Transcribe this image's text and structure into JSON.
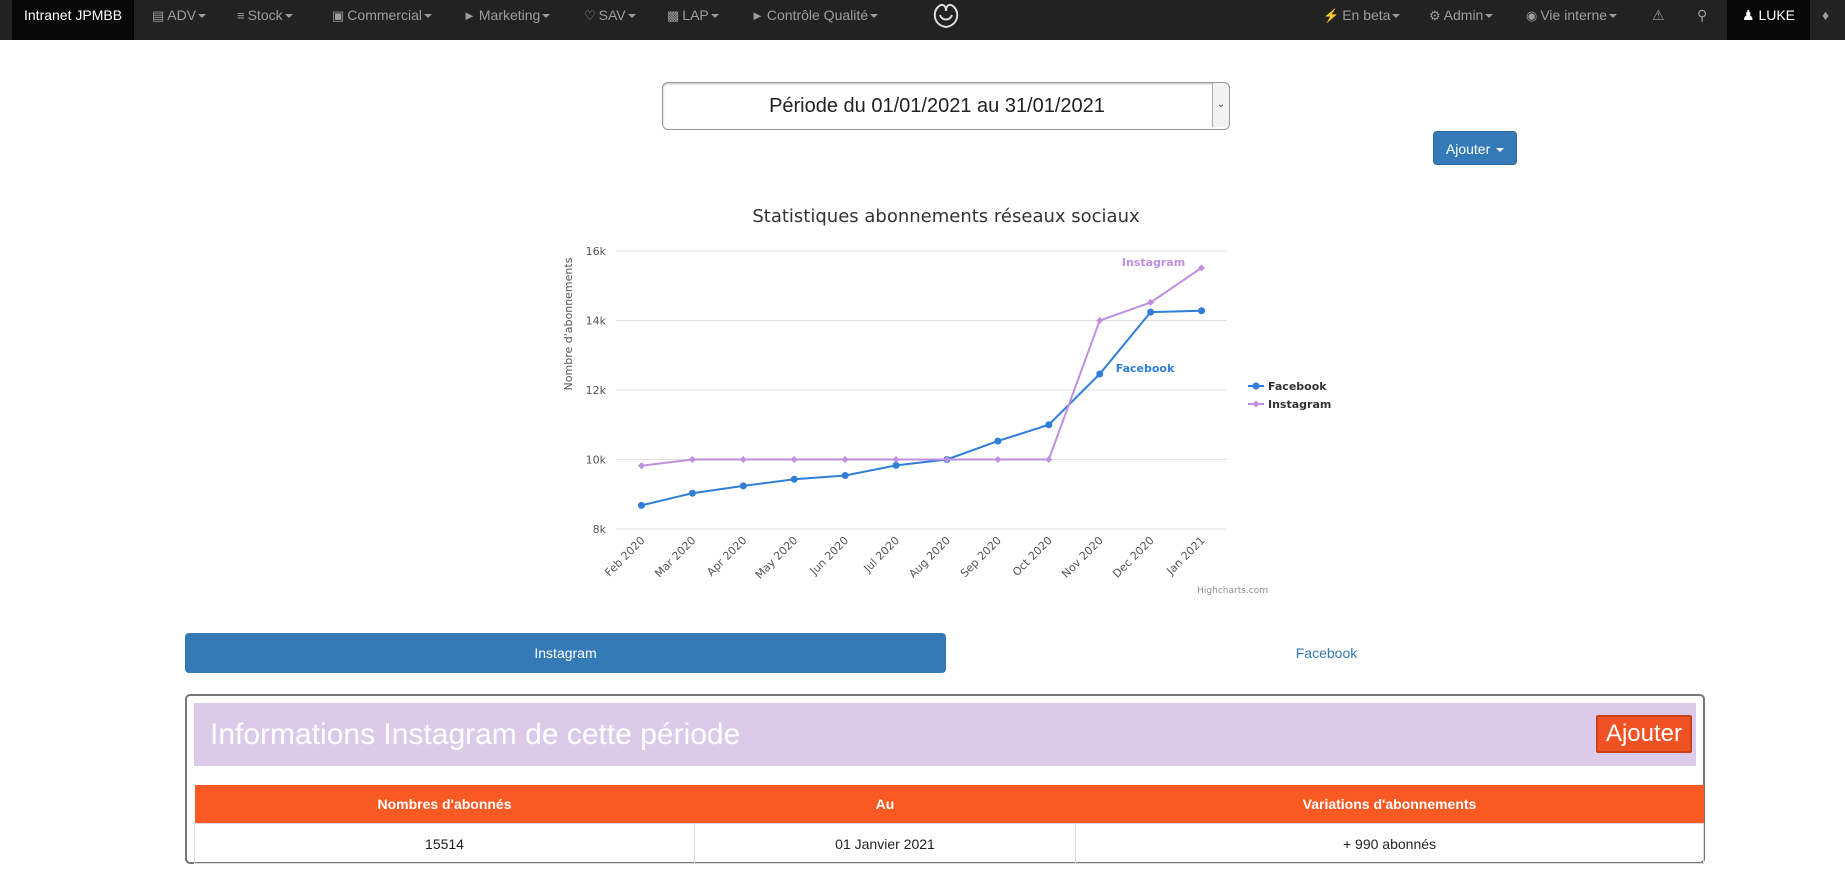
{
  "navbar": {
    "brand": "Intranet JPMBB",
    "items": [
      {
        "label": "ADV",
        "icon": "inbox-icon"
      },
      {
        "label": "Stock",
        "icon": "list-icon"
      },
      {
        "label": "Commercial",
        "icon": "cart-icon"
      },
      {
        "label": "Marketing",
        "icon": "tags-icon"
      },
      {
        "label": "SAV",
        "icon": "heart-icon"
      },
      {
        "label": "LAP",
        "icon": "briefcase-icon"
      },
      {
        "label": "Contrôle Qualité",
        "icon": "tags-icon"
      },
      {
        "label": "En beta",
        "icon": "flash-icon"
      },
      {
        "label": "Admin",
        "icon": "cog-icon"
      },
      {
        "label": "Vie interne",
        "icon": "globe-icon"
      }
    ],
    "user": "LUKE"
  },
  "period": {
    "label": "Période du 01/01/2021 au 31/01/2021"
  },
  "actions": {
    "add_top": "Ajouter",
    "add_panel": "Ajouter"
  },
  "chart_data": {
    "type": "line",
    "title": "Statistiques abonnements réseaux sociaux",
    "ylabel": "Nombre d'abonnements",
    "xlabel": "",
    "ylim": [
      8000,
      16000
    ],
    "yticks": [
      "8k",
      "10k",
      "12k",
      "14k",
      "16k"
    ],
    "categories": [
      "Feb 2020",
      "Mar 2020",
      "Apr 2020",
      "May 2020",
      "Jun 2020",
      "Jul 2020",
      "Aug 2020",
      "Sep 2020",
      "Oct 2020",
      "Nov 2020",
      "Dec 2020",
      "Jan 2021"
    ],
    "series": [
      {
        "name": "Facebook",
        "color": "#2f7ed8",
        "marker": "circle",
        "values": [
          8680,
          9030,
          9240,
          9430,
          9540,
          9830,
          10000,
          10530,
          11000,
          12460,
          14240,
          14280
        ]
      },
      {
        "name": "Instagram",
        "color": "#bf8fe0",
        "marker": "diamond",
        "values": [
          9820,
          10000,
          10000,
          10000,
          10000,
          10000,
          10000,
          10000,
          10000,
          14000,
          14520,
          15514
        ]
      }
    ],
    "credits": "Highcharts.com",
    "legend": "right"
  },
  "tabs": {
    "active": "Instagram",
    "other": "Facebook"
  },
  "panel": {
    "title": "Informations Instagram de cette période",
    "headers": [
      "Nombres d'abonnés",
      "Au",
      "Variations d'abonnements"
    ],
    "row": [
      "15514",
      "01 Janvier 2021",
      "+ 990 abonnés"
    ]
  }
}
